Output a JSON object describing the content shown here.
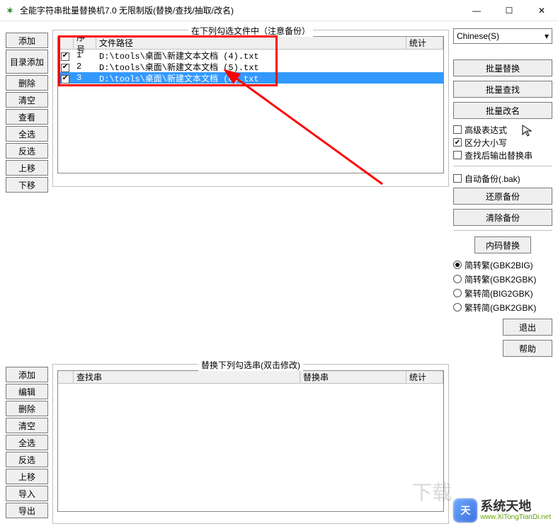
{
  "window": {
    "title": "全能字符串批量替换机7.0 无限制版(替换/查找/抽取/改名)",
    "icon_glyph": "✶"
  },
  "winctrl": {
    "min": "—",
    "max": "☐",
    "close": "✕"
  },
  "top_section": {
    "legend": "在下列勾选文件中（注意备份）",
    "left_buttons": [
      "添加",
      "目录添加",
      "删除",
      "清空",
      "查看",
      "全选",
      "反选",
      "上移",
      "下移"
    ],
    "columns": {
      "seq": "序号",
      "path": "文件路径",
      "stat": "统计"
    },
    "rows": [
      {
        "checked": true,
        "seq": "1",
        "path": "D:\\tools\\桌面\\新建文本文档 (4).txt",
        "selected": false
      },
      {
        "checked": true,
        "seq": "2",
        "path": "D:\\tools\\桌面\\新建文本文档 (5).txt",
        "selected": false
      },
      {
        "checked": true,
        "seq": "3",
        "path": "D:\\tools\\桌面\\新建文本文档 (6).txt",
        "selected": true
      }
    ]
  },
  "bottom_section": {
    "legend": "替换下列勾选串(双击修改)",
    "left_buttons": [
      "添加",
      "编辑",
      "删除",
      "清空",
      "全选",
      "反选",
      "上移",
      "导入",
      "导出"
    ],
    "columns": {
      "search": "查找串",
      "replace": "替换串",
      "stat": "统计"
    }
  },
  "right": {
    "language": "Chinese(S)",
    "actions": {
      "replace": "批量替换",
      "find": "批量查找",
      "rename": "批量改名"
    },
    "opts": {
      "adv": {
        "label": "高级表达式",
        "checked": false
      },
      "case": {
        "label": "区分大小写",
        "checked": true
      },
      "out": {
        "label": "查找后输出替换串",
        "checked": false
      }
    },
    "backup": {
      "auto": {
        "label": "自动备份(.bak)",
        "checked": false
      },
      "restore": "还原备份",
      "clear": "清除备份"
    },
    "encoding": {
      "title": "内码替换",
      "options": [
        {
          "label": "简转繁(GBK2BIG)",
          "selected": true
        },
        {
          "label": "简转繁(GBK2GBK)",
          "selected": false
        },
        {
          "label": "繁转简(BIG2GBK)",
          "selected": false
        },
        {
          "label": "繁转简(GBK2GBK)",
          "selected": false
        }
      ]
    },
    "exit": "退出",
    "help": "帮助"
  },
  "watermark": {
    "cn": "系统天地",
    "en": "www.XiTongTianDi.net",
    "logo": "天"
  }
}
